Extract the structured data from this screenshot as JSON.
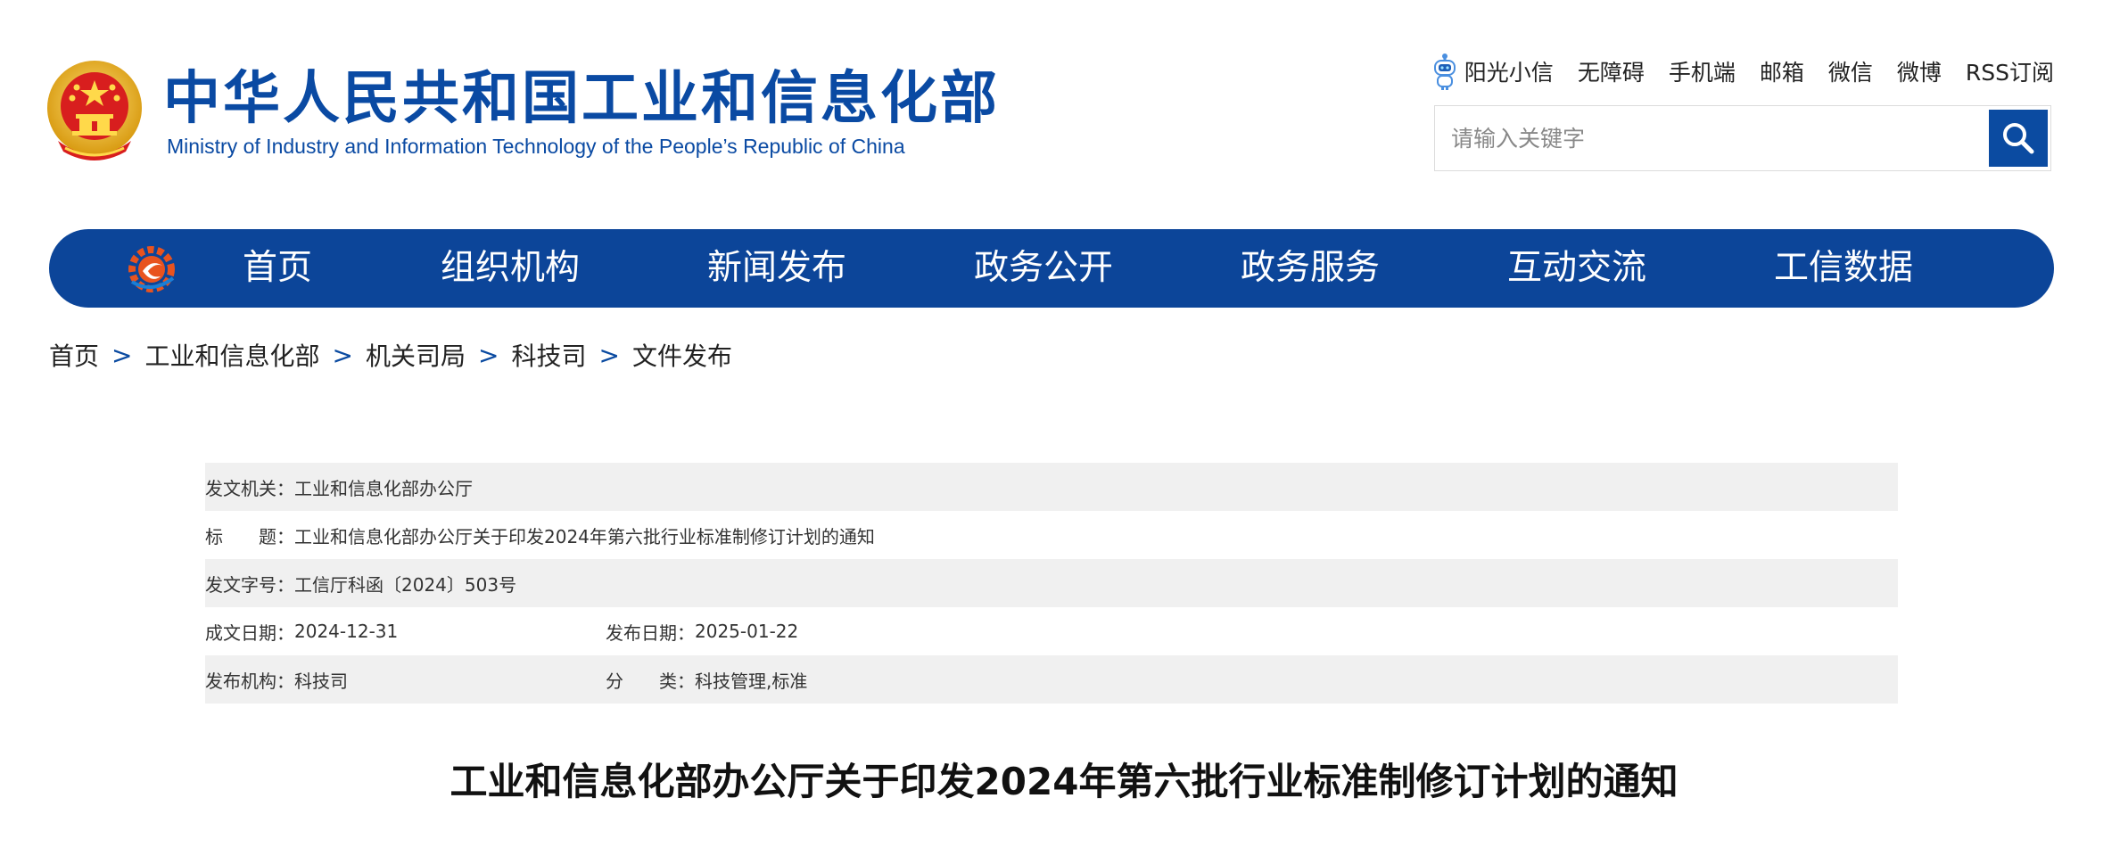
{
  "header": {
    "title_cn": "中华人民共和国工业和信息化部",
    "title_en": "Ministry of Industry and Information Technology of the People’s Republic of China",
    "links": [
      "阳光小信",
      "无障碍",
      "手机端",
      "邮箱",
      "微信",
      "微博",
      "RSS订阅"
    ],
    "search_placeholder": "请输入关键字",
    "emblem_icon": "national-emblem-icon",
    "search_icon": "search-icon"
  },
  "nav": {
    "items": [
      "首页",
      "组织机构",
      "新闻发布",
      "政务公开",
      "政务服务",
      "互动交流",
      "工信数据"
    ],
    "color": "#0c4599"
  },
  "breadcrumb": [
    "首页",
    "工业和信息化部",
    "机关司局",
    "科技司",
    "文件发布"
  ],
  "info": {
    "issuer_label": "发文机关：",
    "issuer": "工业和信息化部办公厅",
    "title_label": "标　　题：",
    "title": "工业和信息化部办公厅关于印发2024年第六批行业标准制修订计划的通知",
    "docno_label": "发文字号：",
    "docno": "工信厅科函〔2024〕503号",
    "created_label": "成文日期：",
    "created": "2024-12-31",
    "published_label": "发布日期：",
    "published": "2025-01-22",
    "org_label": "发布机构：",
    "org": "科技司",
    "category_label": "分　　类：",
    "category": "科技管理,标准"
  },
  "doc_title": "工业和信息化部办公厅关于印发2024年第六批行业标准制修订计划的通知",
  "colors": {
    "brand_blue": "#0a4aa3",
    "row_shade": "#f0f0f0"
  }
}
